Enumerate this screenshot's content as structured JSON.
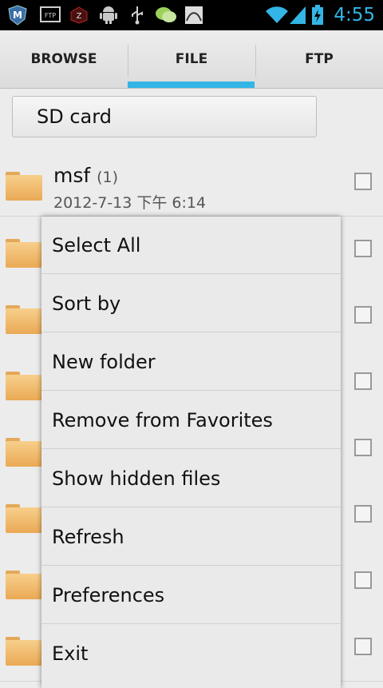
{
  "status_bar": {
    "time": "4:55",
    "icons": [
      "shield-m-icon",
      "ftp-icon",
      "z-icon",
      "android-icon",
      "usb-icon",
      "wechat-icon",
      "image-icon",
      "wifi-icon",
      "signal-icon",
      "battery-icon"
    ],
    "labels": {
      "m": "M",
      "ftp": "FTP",
      "z": "Z"
    }
  },
  "tabs": [
    {
      "label": "BROWSE",
      "selected": false
    },
    {
      "label": "FILE",
      "selected": true
    },
    {
      "label": "FTP",
      "selected": false
    }
  ],
  "accent_color": "#33b5e5",
  "path": {
    "label": "SD card"
  },
  "files": [
    {
      "name": "msf",
      "count": "(1)",
      "date": "2012-7-13 下午 6:14"
    }
  ],
  "menu": {
    "items": [
      "Select All",
      "Sort by",
      "New folder",
      "Remove from Favorites",
      "Show hidden files",
      "Refresh",
      "Preferences",
      "Exit"
    ]
  }
}
